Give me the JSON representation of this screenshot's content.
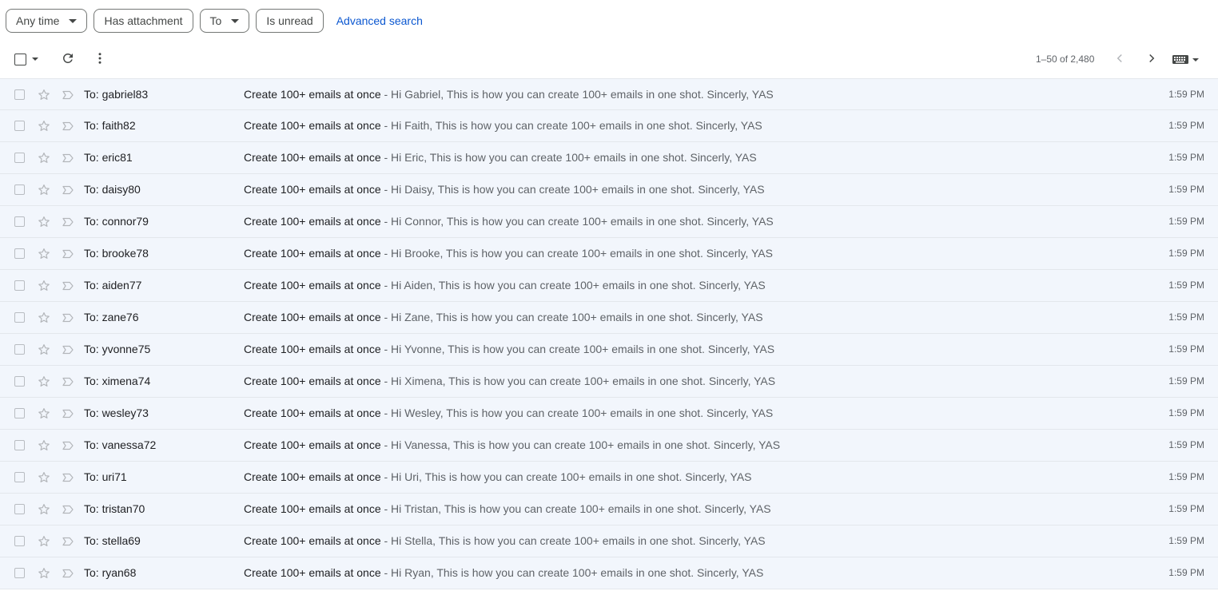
{
  "filters": {
    "any_time": "Any time",
    "has_attachment": "Has attachment",
    "to": "To",
    "is_unread": "Is unread",
    "advanced_search": "Advanced search"
  },
  "toolbar": {
    "pager": "1–50 of 2,480"
  },
  "icons": {
    "select": "checkbox-icon",
    "refresh": "refresh-icon",
    "more": "more-vert-icon",
    "prev": "chevron-left-icon",
    "next": "chevron-right-icon",
    "input_tools": "keyboard-icon",
    "star": "star-icon",
    "important": "important-marker-icon"
  },
  "colors": {
    "row_bg": "#f2f6fc",
    "link": "#0b57d0"
  },
  "emails": [
    {
      "to": "To: gabriel83",
      "subject": "Create 100+ emails at once",
      "snippet": " - Hi Gabriel, This is how you can create 100+ emails in one shot. Sincerly, YAS",
      "time": "1:59 PM"
    },
    {
      "to": "To: faith82",
      "subject": "Create 100+ emails at once",
      "snippet": " - Hi Faith, This is how you can create 100+ emails in one shot. Sincerly, YAS",
      "time": "1:59 PM"
    },
    {
      "to": "To: eric81",
      "subject": "Create 100+ emails at once",
      "snippet": " - Hi Eric, This is how you can create 100+ emails in one shot. Sincerly, YAS",
      "time": "1:59 PM"
    },
    {
      "to": "To: daisy80",
      "subject": "Create 100+ emails at once",
      "snippet": " - Hi Daisy, This is how you can create 100+ emails in one shot. Sincerly, YAS",
      "time": "1:59 PM"
    },
    {
      "to": "To: connor79",
      "subject": "Create 100+ emails at once",
      "snippet": " - Hi Connor, This is how you can create 100+ emails in one shot. Sincerly, YAS",
      "time": "1:59 PM"
    },
    {
      "to": "To: brooke78",
      "subject": "Create 100+ emails at once",
      "snippet": " - Hi Brooke, This is how you can create 100+ emails in one shot. Sincerly, YAS",
      "time": "1:59 PM"
    },
    {
      "to": "To: aiden77",
      "subject": "Create 100+ emails at once",
      "snippet": " - Hi Aiden, This is how you can create 100+ emails in one shot. Sincerly, YAS",
      "time": "1:59 PM"
    },
    {
      "to": "To: zane76",
      "subject": "Create 100+ emails at once",
      "snippet": " - Hi Zane, This is how you can create 100+ emails in one shot. Sincerly, YAS",
      "time": "1:59 PM"
    },
    {
      "to": "To: yvonne75",
      "subject": "Create 100+ emails at once",
      "snippet": " - Hi Yvonne, This is how you can create 100+ emails in one shot. Sincerly, YAS",
      "time": "1:59 PM"
    },
    {
      "to": "To: ximena74",
      "subject": "Create 100+ emails at once",
      "snippet": " - Hi Ximena, This is how you can create 100+ emails in one shot. Sincerly, YAS",
      "time": "1:59 PM"
    },
    {
      "to": "To: wesley73",
      "subject": "Create 100+ emails at once",
      "snippet": " - Hi Wesley, This is how you can create 100+ emails in one shot. Sincerly, YAS",
      "time": "1:59 PM"
    },
    {
      "to": "To: vanessa72",
      "subject": "Create 100+ emails at once",
      "snippet": " - Hi Vanessa, This is how you can create 100+ emails in one shot. Sincerly, YAS",
      "time": "1:59 PM"
    },
    {
      "to": "To: uri71",
      "subject": "Create 100+ emails at once",
      "snippet": " - Hi Uri, This is how you can create 100+ emails in one shot. Sincerly, YAS",
      "time": "1:59 PM"
    },
    {
      "to": "To: tristan70",
      "subject": "Create 100+ emails at once",
      "snippet": " - Hi Tristan, This is how you can create 100+ emails in one shot. Sincerly, YAS",
      "time": "1:59 PM"
    },
    {
      "to": "To: stella69",
      "subject": "Create 100+ emails at once",
      "snippet": " - Hi Stella, This is how you can create 100+ emails in one shot. Sincerly, YAS",
      "time": "1:59 PM"
    },
    {
      "to": "To: ryan68",
      "subject": "Create 100+ emails at once",
      "snippet": " - Hi Ryan, This is how you can create 100+ emails in one shot. Sincerly, YAS",
      "time": "1:59 PM"
    }
  ]
}
